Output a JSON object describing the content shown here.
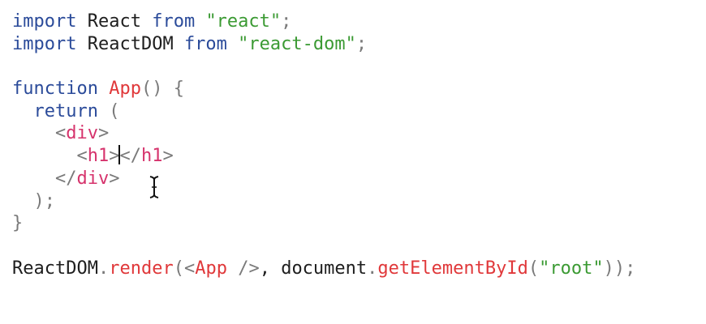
{
  "editor": {
    "lines": [
      {
        "segments": [
          {
            "text": "import",
            "class": "kw"
          },
          {
            "text": " React ",
            "class": "plain"
          },
          {
            "text": "from",
            "class": "kw"
          },
          {
            "text": " ",
            "class": "plain"
          },
          {
            "text": "\"react\"",
            "class": "str"
          },
          {
            "text": ";",
            "class": "punc"
          }
        ]
      },
      {
        "segments": [
          {
            "text": "import",
            "class": "kw"
          },
          {
            "text": " ReactDOM ",
            "class": "plain"
          },
          {
            "text": "from",
            "class": "kw"
          },
          {
            "text": " ",
            "class": "plain"
          },
          {
            "text": "\"react-dom\"",
            "class": "str"
          },
          {
            "text": ";",
            "class": "punc"
          }
        ]
      },
      {
        "segments": []
      },
      {
        "segments": [
          {
            "text": "function",
            "class": "kw"
          },
          {
            "text": " ",
            "class": "plain"
          },
          {
            "text": "App",
            "class": "fn"
          },
          {
            "text": "() {",
            "class": "punc"
          }
        ]
      },
      {
        "segments": [
          {
            "text": "  ",
            "class": "plain"
          },
          {
            "text": "return",
            "class": "kw"
          },
          {
            "text": " (",
            "class": "punc"
          }
        ]
      },
      {
        "segments": [
          {
            "text": "    ",
            "class": "plain"
          },
          {
            "text": "<",
            "class": "punc"
          },
          {
            "text": "div",
            "class": "tag"
          },
          {
            "text": ">",
            "class": "punc"
          }
        ]
      },
      {
        "segments": [
          {
            "text": "      ",
            "class": "plain"
          },
          {
            "text": "<",
            "class": "punc"
          },
          {
            "text": "h1",
            "class": "tag"
          },
          {
            "text": ">",
            "class": "punc"
          },
          {
            "caret": true
          },
          {
            "text": "</",
            "class": "punc"
          },
          {
            "text": "h1",
            "class": "tag"
          },
          {
            "text": ">",
            "class": "punc"
          }
        ]
      },
      {
        "segments": [
          {
            "text": "    ",
            "class": "plain"
          },
          {
            "text": "</",
            "class": "punc"
          },
          {
            "text": "div",
            "class": "tag"
          },
          {
            "text": ">",
            "class": "punc"
          }
        ]
      },
      {
        "segments": [
          {
            "text": "  ",
            "class": "plain"
          },
          {
            "text": ");",
            "class": "punc"
          }
        ]
      },
      {
        "segments": [
          {
            "text": "}",
            "class": "punc"
          }
        ]
      },
      {
        "segments": []
      },
      {
        "segments": [
          {
            "text": "ReactDOM",
            "class": "plain"
          },
          {
            "text": ".",
            "class": "punc"
          },
          {
            "text": "render",
            "class": "fn"
          },
          {
            "text": "(<",
            "class": "punc"
          },
          {
            "text": "App",
            "class": "fn"
          },
          {
            "text": " />",
            "class": "punc"
          },
          {
            "text": ", document",
            "class": "plain"
          },
          {
            "text": ".",
            "class": "punc"
          },
          {
            "text": "getElementById",
            "class": "fn"
          },
          {
            "text": "(",
            "class": "punc"
          },
          {
            "text": "\"root\"",
            "class": "str"
          },
          {
            "text": "));",
            "class": "punc"
          }
        ]
      }
    ]
  },
  "colors": {
    "keyword": "#2b4b9a",
    "string": "#3b9a33",
    "function": "#e0383a",
    "tag": "#d6336c",
    "punctuation": "#7a7a7a",
    "text": "#1e1e1e",
    "background": "#ffffff"
  },
  "icons": {
    "mouse_cursor": "i-beam-cursor-icon"
  }
}
